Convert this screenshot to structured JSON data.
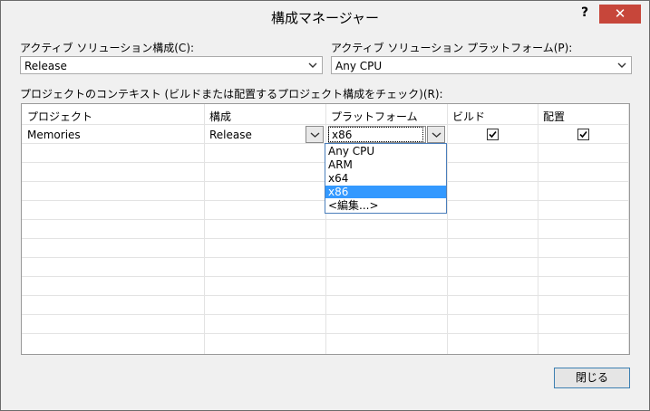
{
  "window": {
    "title": "構成マネージャー",
    "help": "?",
    "close": "✕"
  },
  "active_config": {
    "label": "アクティブ ソリューション構成(C):",
    "value": "Release"
  },
  "active_platform": {
    "label": "アクティブ ソリューション プラットフォーム(P):",
    "value": "Any CPU"
  },
  "context": {
    "label": "プロジェクトのコンテキスト (ビルドまたは配置するプロジェクト構成をチェック)(R):"
  },
  "grid": {
    "headers": [
      "プロジェクト",
      "構成",
      "プラットフォーム",
      "ビルド",
      "配置"
    ],
    "rows": [
      {
        "project": "Memories",
        "config": "Release",
        "platform": "x86",
        "build": true,
        "deploy": true
      }
    ]
  },
  "platform_dropdown": {
    "options": [
      "Any CPU",
      "ARM",
      "x64",
      "x86",
      "<編集...>"
    ],
    "selected_index": 3
  },
  "footer": {
    "close_label": "閉じる"
  },
  "colors": {
    "selection": "#3399ff",
    "close_button": "#c7463a",
    "dropdown_border": "#4a7ebb"
  }
}
